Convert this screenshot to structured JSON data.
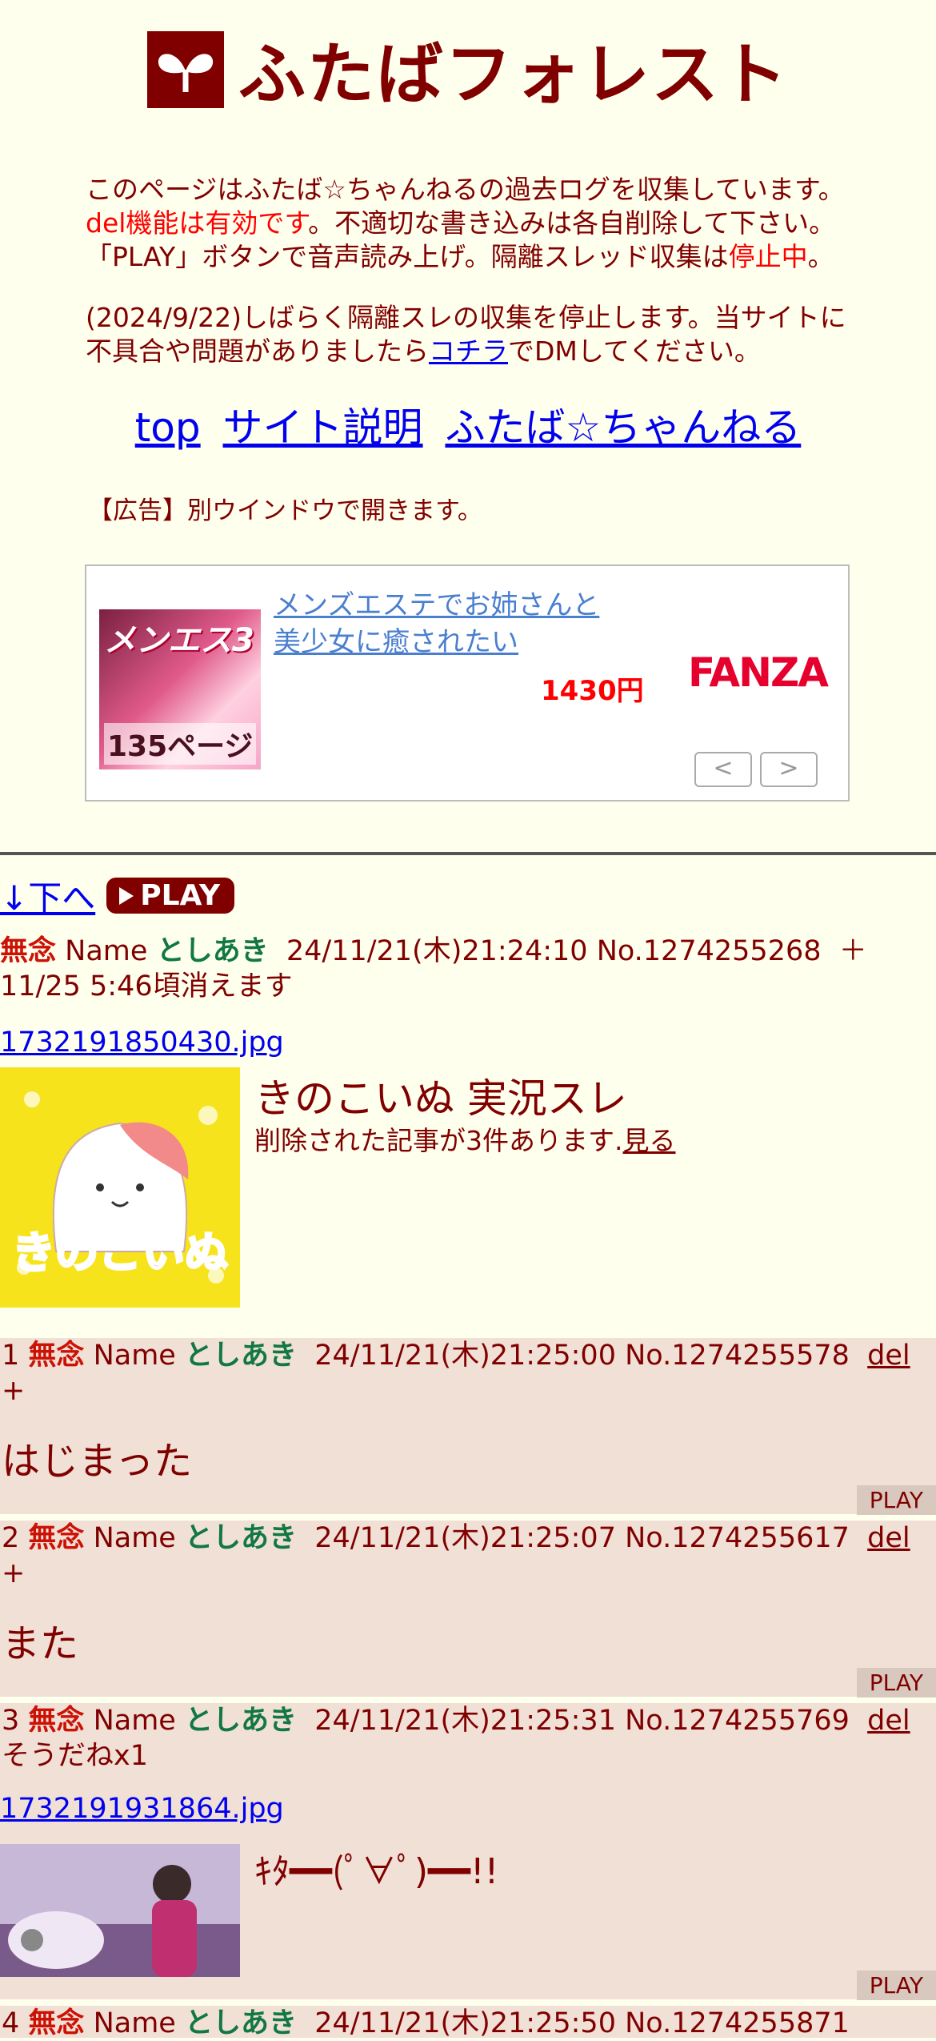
{
  "header": {
    "title": "ふたばフォレスト"
  },
  "intro": {
    "p1_a": "このページはふたば☆ちゃんねるの過去ログを収集しています。",
    "p1_red": "del機能は有効です",
    "p1_b": "。不適切な書き込みは各自削除して下さい。「PLAY」ボタンで音声読み上げ。隔離スレッド収集は",
    "p1_red2": "停止中",
    "p1_c": "。",
    "p2_a": "(2024/9/22)しばらく隔離スレの収集を停止します。当サイトに不具合や問題がありましたら",
    "p2_link": "コチラ",
    "p2_b": "でDMしてください。"
  },
  "nav": {
    "top": "top",
    "about": "サイト説明",
    "futaba": "ふたば☆ちゃんねる"
  },
  "ad": {
    "label": "【広告】別ウインドウで開きます。",
    "thumb_text1": "メンエス3",
    "thumb_text2": "135ページ",
    "link": "メンズエステでお姉さんと美少女に癒されたい",
    "price": "1430円",
    "brand": "FANZA",
    "prev": "<",
    "next": ">"
  },
  "controls": {
    "down": "↓下へ",
    "play": "PLAY"
  },
  "op": {
    "subject": "無念",
    "name_label": "Name",
    "name": "としあき",
    "datetime": "24/11/21(木)21:24:10",
    "no": "No.1274255268",
    "expire": "＋ 11/25 5:46頃消えます",
    "file": "1732191850430.jpg",
    "title": "きのこいぬ 実況スレ",
    "deleted_text": "削除された記事が3件あります.",
    "deleted_link": "見る",
    "img_caption": "きのこいぬ"
  },
  "replies": [
    {
      "num": "1",
      "subject": "無念",
      "name_label": "Name",
      "name": "としあき",
      "datetime": "24/11/21(木)21:25:00",
      "no": "No.1274255578",
      "del": "del",
      "extra": "+",
      "body": "はじまった",
      "play": "PLAY"
    },
    {
      "num": "2",
      "subject": "無念",
      "name_label": "Name",
      "name": "としあき",
      "datetime": "24/11/21(木)21:25:07",
      "no": "No.1274255617",
      "del": "del",
      "extra": "+",
      "body": "また",
      "play": "PLAY"
    },
    {
      "num": "3",
      "subject": "無念",
      "name_label": "Name",
      "name": "としあき",
      "datetime": "24/11/21(木)21:25:31",
      "no": "No.1274255769",
      "del": "del",
      "extra": "そうだねx1",
      "file": "1732191931864.jpg",
      "body": "ｷﾀ━━(ﾟ∀ﾟ)━━!!",
      "play": "PLAY"
    },
    {
      "num": "4",
      "subject": "無念",
      "name_label": "Name",
      "name": "としあき",
      "datetime": "24/11/21(木)21:25:50",
      "no": "No.1274255871"
    }
  ],
  "colors": {
    "background": "#ffffee",
    "text": "#800000",
    "reply_bg": "#f0e0d6",
    "subject": "#cc1105",
    "name": "#117743",
    "link": "#0000ee"
  }
}
